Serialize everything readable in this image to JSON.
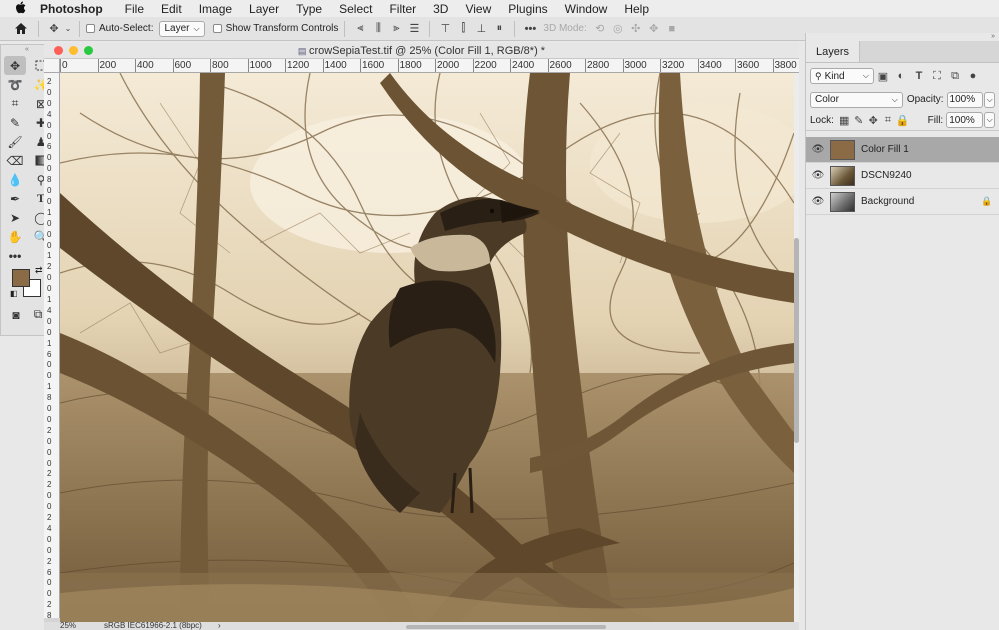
{
  "menubar": {
    "apple": "",
    "app": "Photoshop",
    "items": [
      "File",
      "Edit",
      "Image",
      "Layer",
      "Type",
      "Select",
      "Filter",
      "3D",
      "View",
      "Plugins",
      "Window",
      "Help"
    ]
  },
  "options": {
    "auto_select_label": "Auto-Select:",
    "auto_select_value": "Layer",
    "show_transform_label": "Show Transform Controls",
    "three_d_mode_label": "3D Mode:"
  },
  "document": {
    "title": "crowSepiaTest.tif @ 25% (Color Fill 1, RGB/8*) *",
    "h_ruler": [
      "0",
      "200",
      "400",
      "600",
      "800",
      "1000",
      "1200",
      "1400",
      "1600",
      "1800",
      "2000",
      "2200",
      "2400",
      "2600",
      "2800",
      "3000",
      "3200",
      "3400",
      "3600",
      "3800"
    ],
    "v_ruler": [
      "2",
      "0",
      "0",
      "4",
      "0",
      "0",
      "6",
      "0",
      "0",
      "8",
      "0",
      "0",
      "1",
      "0",
      "0",
      "0",
      "1",
      "2",
      "0",
      "0",
      "1",
      "4",
      "0",
      "0",
      "1",
      "6",
      "0",
      "0",
      "1",
      "8",
      "0",
      "0",
      "2",
      "0",
      "0",
      "0",
      "2",
      "2",
      "0",
      "0",
      "2",
      "4",
      "0",
      "0",
      "2",
      "6",
      "0",
      "0",
      "2",
      "8"
    ],
    "zoom": "25%",
    "profile": "sRGB IEC61966-2.1 (8bpc)"
  },
  "colors": {
    "foreground": "#8b6b45",
    "background": "#ffffff",
    "sepia_sky": "#f1e6cf",
    "sepia_dark": "#3a2c1c",
    "selected_layer": "#a8a8a8",
    "fill_swatch": "#8b6b45"
  },
  "layers_panel": {
    "tab": "Layers",
    "filter_kind": "Kind",
    "blend_mode": "Color",
    "opacity_label": "Opacity:",
    "opacity_value": "100%",
    "lock_label": "Lock:",
    "fill_label": "Fill:",
    "fill_value": "100%",
    "layers": [
      {
        "name": "Color Fill 1",
        "selected": true,
        "locked": false
      },
      {
        "name": "DSCN9240",
        "selected": false,
        "locked": false
      },
      {
        "name": "Background",
        "selected": false,
        "locked": true
      }
    ]
  }
}
